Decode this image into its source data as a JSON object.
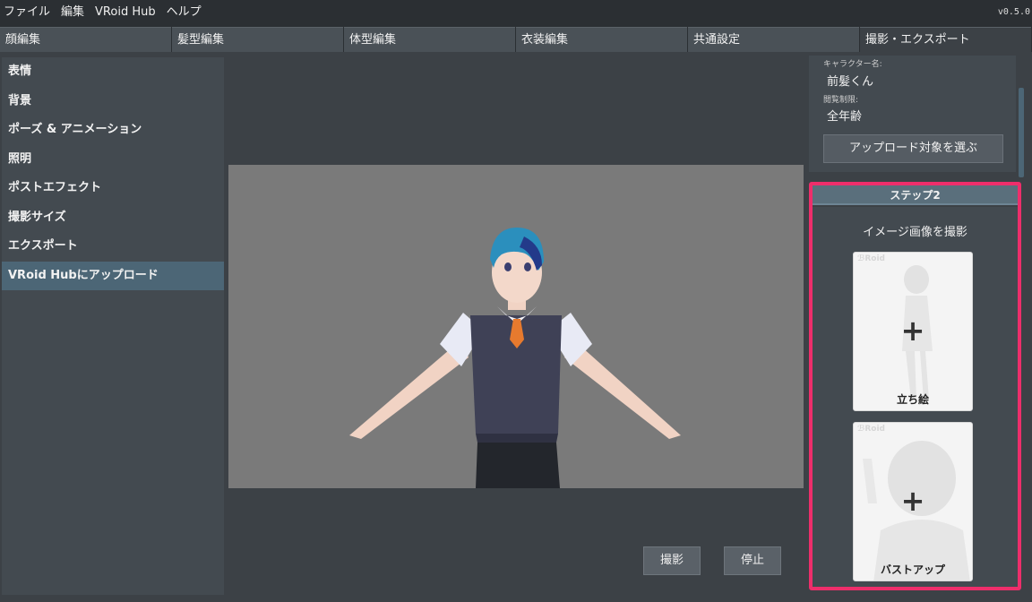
{
  "menu": {
    "items": [
      "ファイル",
      "編集",
      "VRoid Hub",
      "ヘルプ"
    ],
    "version": "v0.5.0"
  },
  "tabs": [
    "顔編集",
    "髪型編集",
    "体型編集",
    "衣装編集",
    "共通設定",
    "撮影・エクスポート"
  ],
  "active_tab": "撮影・エクスポート",
  "sidebar": {
    "items": [
      "表情",
      "背景",
      "ポーズ & アニメーション",
      "照明",
      "ポストエフェクト",
      "撮影サイズ",
      "エクスポート",
      "VRoid Hubにアップロード"
    ],
    "active": "VRoid Hubにアップロード"
  },
  "actions": {
    "capture": "撮影",
    "stop": "停止"
  },
  "info": {
    "character_label": "キャラクター名:",
    "character_name": "前髪くん",
    "rating_label": "閲覧制限:",
    "rating_value": "全年齢",
    "select_button": "アップロード対象を選ぶ"
  },
  "step": {
    "header": "ステップ2",
    "title": "イメージ画像を撮影",
    "cards": [
      {
        "brand": "ℬRoid",
        "plus": "+",
        "label": "立ち絵"
      },
      {
        "brand": "ℬRoid",
        "plus": "+",
        "label": "バストアップ"
      }
    ]
  },
  "colors": {
    "accent": "#4c6676",
    "highlight": "#ee2e6b",
    "background": "#3c4146",
    "viewport": "#7a7a7a"
  }
}
